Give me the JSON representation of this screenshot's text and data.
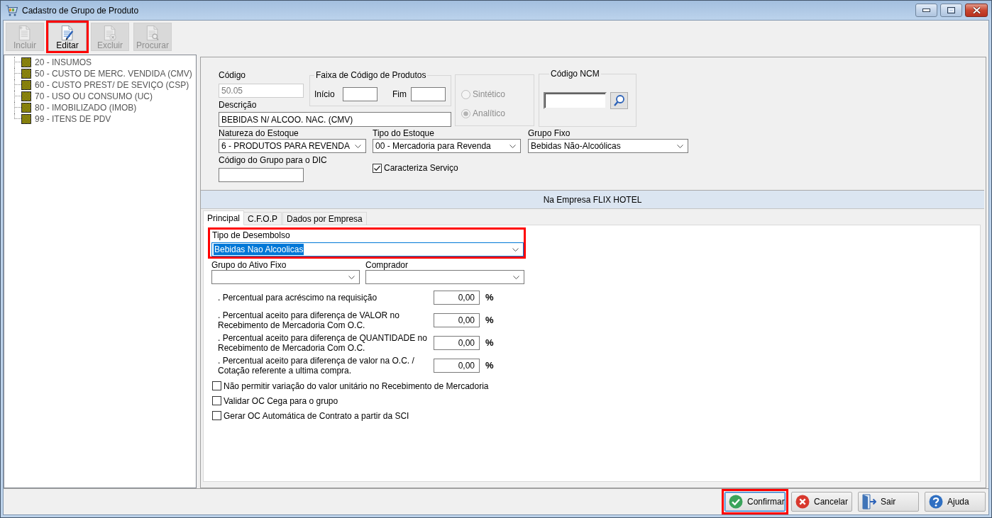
{
  "window": {
    "title": "Cadastro de Grupo de Produto"
  },
  "toolbar": [
    {
      "label": "Incluir",
      "kind": "new",
      "disabled": true,
      "highlighted": false
    },
    {
      "label": "Editar",
      "kind": "edit",
      "disabled": false,
      "highlighted": true
    },
    {
      "label": "Excluir",
      "kind": "delete",
      "disabled": true,
      "highlighted": false
    },
    {
      "label": "Procurar",
      "kind": "search",
      "disabled": true,
      "highlighted": false
    }
  ],
  "tree": {
    "items": [
      {
        "label": "20 - INSUMOS"
      },
      {
        "label": "50 - CUSTO DE MERC. VENDIDA (CMV)"
      },
      {
        "label": "60 - CUSTO PREST/ DE SEVIÇO (CSP)"
      },
      {
        "label": "70 - USO OU CONSUMO (UC)"
      },
      {
        "label": "80 - IMOBILIZADO (IMOB)"
      },
      {
        "label": "99 - ITENS DE PDV"
      }
    ]
  },
  "form": {
    "codigo": {
      "label": "Código",
      "value": "50.05",
      "disabled": true
    },
    "faixa": {
      "title": "Faixa de Código de Produtos",
      "start_label": "Início",
      "end_label": "Fim"
    },
    "descricao": {
      "label": "Descrição",
      "value": "BEBIDAS N/ ALCOO. NAC. (CMV)"
    },
    "tipo": {
      "disabled": true,
      "options": [
        {
          "label": "Sintético",
          "selected": false
        },
        {
          "label": "Analítico",
          "selected": true
        }
      ]
    },
    "ncm": {
      "title": "Código NCM"
    },
    "selects": [
      {
        "label": "Natureza do Estoque",
        "value": "6 - PRODUTOS PARA REVENDA"
      },
      {
        "label": "Tipo do Estoque",
        "value": "00 - Mercadoria para Revenda"
      },
      {
        "label": "Grupo Fixo",
        "value": "Bebidas Não-Alcoólicas"
      }
    ],
    "codigo_dic": {
      "label": "Código do Grupo para o DIC"
    },
    "caracteriza_servico": {
      "label": "Caracteriza Serviço",
      "checked": true
    }
  },
  "banner": "Na Empresa FLIX HOTEL",
  "tabs": [
    {
      "label": "Principal",
      "selected": true
    },
    {
      "label": "C.F.O.P",
      "selected": false
    },
    {
      "label": "Dados por Empresa",
      "selected": false
    }
  ],
  "principal": {
    "tipo_desembolso": {
      "label": "Tipo de Desembolso",
      "value": "Bebidas Nao Alcoolicas",
      "focused": true,
      "highlighted": true
    },
    "selects": [
      {
        "label": "Grupo do Ativo Fixo"
      },
      {
        "label": "Comprador"
      }
    ],
    "percentuais": [
      {
        "lines": [
          ". Percentual para acréscimo na requisição"
        ],
        "value": "0,00",
        "unit": "%"
      },
      {
        "lines": [
          ". Percentual aceito para diferença de VALOR no",
          "Recebimento de Mercadoria Com O.C."
        ],
        "value": "0,00",
        "unit": "%"
      },
      {
        "lines": [
          ". Percentual aceito para diferença de QUANTIDADE no",
          "Recebimento de Mercadoria Com O.C."
        ],
        "value": "0,00",
        "unit": "%"
      },
      {
        "lines": [
          ". Percentual aceito para diferença de valor na O.C. /",
          "Cotação referente a ultima compra."
        ],
        "value": "0,00",
        "unit": "%"
      }
    ],
    "options": [
      {
        "label": "Não permitir variação do valor unitário no Recebimento de Mercadoria",
        "checked": false
      },
      {
        "label": "Validar OC Cega para o grupo",
        "checked": false
      },
      {
        "label": "Gerar OC Automática de Contrato a partir da SCI",
        "checked": false
      }
    ]
  },
  "buttons": [
    {
      "label": "Confirmar",
      "kind": "confirm",
      "default": true,
      "highlighted": true
    },
    {
      "label": "Cancelar",
      "kind": "cancel",
      "default": false,
      "highlighted": false
    },
    {
      "label": "Sair",
      "kind": "exit",
      "default": false,
      "highlighted": false
    },
    {
      "label": "Ajuda",
      "kind": "help",
      "default": false,
      "highlighted": false
    }
  ]
}
